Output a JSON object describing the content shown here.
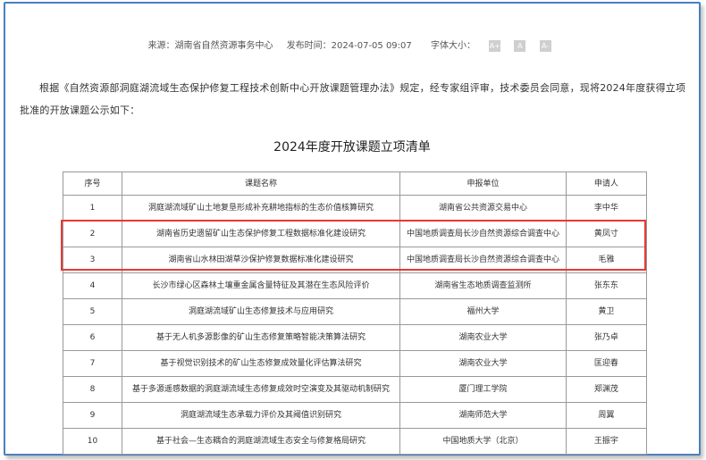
{
  "meta": {
    "source": "来源：湖南省自然资源事务中心",
    "published": "发布时间：2024-07-05 09:07",
    "font_size_label": "字体大小：",
    "font_buttons": [
      "A+",
      "A",
      "A-"
    ]
  },
  "intro": "根据《自然资源部洞庭湖流域生态保护修复工程技术创新中心开放课题管理办法》规定，经专家组评审，技术委员会同意，现将2024年度获得立项批准的开放课题公示如下：",
  "table_title": "2024年度开放课题立项清单",
  "table": {
    "headers": [
      "序号",
      "课题名称",
      "申报单位",
      "申请人"
    ],
    "rows": [
      [
        "1",
        "洞庭湖流域矿山土地复垦形成补充耕地指标的生态价值核算研究",
        "湖南省公共资源交易中心",
        "李中华"
      ],
      [
        "2",
        "湖南省历史遗留矿山生态保护修复工程数据标准化建设研究",
        "中国地质调查局长沙自然资源综合调查中心",
        "黄凤寸"
      ],
      [
        "3",
        "湖南省山水林田湖草沙保护修复数据标准化建设研究",
        "中国地质调查局长沙自然资源综合调查中心",
        "毛雅"
      ],
      [
        "4",
        "长沙市绿心区森林土壤重金属含量特征及其潜在生态风险评价",
        "湖南省生态地质调查监测所",
        "张东东"
      ],
      [
        "5",
        "洞庭湖流域矿山生态修复技术与应用研究",
        "福州大学",
        "黄卫"
      ],
      [
        "6",
        "基于无人机多源影像的矿山生态修复策略智能决策算法研究",
        "湖南农业大学",
        "张乃卓"
      ],
      [
        "7",
        "基于视觉识别技术的矿山生态修复成效量化评估算法研究",
        "湖南农业大学",
        "匡迎春"
      ],
      [
        "8",
        "基于多源遥感数据的洞庭湖流域生态修复成效时空演变及其驱动机制研究",
        "厦门理工学院",
        "郑渊茂"
      ],
      [
        "9",
        "洞庭湖流域生态承载力评价及其阈值识别研究",
        "湖南师范大学",
        "周翼"
      ],
      [
        "10",
        "基于社会—生态耦合的洞庭湖流域生态安全与修复格局研究",
        "中国地质大学（北京）",
        "王振宇"
      ]
    ]
  },
  "colors": {
    "frame": "#4a7fc1",
    "highlight": "#e53935",
    "border": "#999999"
  }
}
